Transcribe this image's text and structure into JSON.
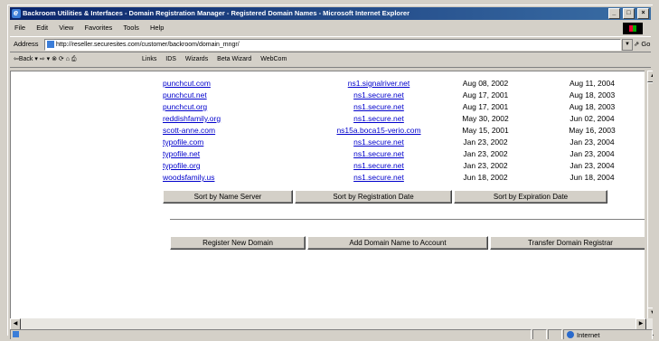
{
  "window": {
    "title": "Backroom Utilities & Interfaces - Domain Registration Manager - Registered Domain Names - Microsoft Internet Explorer",
    "controls": [
      "_",
      "□",
      "×"
    ]
  },
  "menu": [
    "File",
    "Edit",
    "View",
    "Favorites",
    "Tools",
    "Help"
  ],
  "address": {
    "label": "Address",
    "url": "http://reseller.securesites.com/customer/backroom/domain_mngr/",
    "go_label": "Go"
  },
  "toolbar": {
    "nav": "⇦Back ▾ ⇨ ▾ ⊗ ⟳ ⌂ ⎙",
    "links_label": "Links",
    "links": [
      "IDS",
      "Wizards",
      "Beta Wizard",
      "WebCom"
    ]
  },
  "domains": [
    {
      "name": "punchcut.com",
      "ns": "ns1.signalriver.net",
      "reg": "Aug 08, 2002",
      "exp": "Aug 11, 2004"
    },
    {
      "name": "punchcut.net",
      "ns": "ns1.secure.net",
      "reg": "Aug 17, 2001",
      "exp": "Aug 18, 2003"
    },
    {
      "name": "punchcut.org",
      "ns": "ns1.secure.net",
      "reg": "Aug 17, 2001",
      "exp": "Aug 18, 2003"
    },
    {
      "name": "reddishfamily.org",
      "ns": "ns1.secure.net",
      "reg": "May 30, 2002",
      "exp": "Jun 02, 2004"
    },
    {
      "name": "scott-anne.com",
      "ns": "ns15a.boca15-verio.com",
      "reg": "May 15, 2001",
      "exp": "May 16, 2003"
    },
    {
      "name": "typofile.com",
      "ns": "ns1.secure.net",
      "reg": "Jan 23, 2002",
      "exp": "Jan 23, 2004"
    },
    {
      "name": "typofile.net",
      "ns": "ns1.secure.net",
      "reg": "Jan 23, 2002",
      "exp": "Jan 23, 2004"
    },
    {
      "name": "typofile.org",
      "ns": "ns1.secure.net",
      "reg": "Jan 23, 2002",
      "exp": "Jan 23, 2004"
    },
    {
      "name": "woodsfamily.us",
      "ns": "ns1.secure.net",
      "reg": "Jun 18, 2002",
      "exp": "Jun 18, 2004"
    }
  ],
  "sort_buttons": {
    "by_ns": "Sort by Name Server",
    "by_reg": "Sort by Registration Date",
    "by_exp": "Sort by Expiration Date"
  },
  "action_buttons": {
    "register": "Register New Domain",
    "add": "Add Domain Name to Account",
    "transfer": "Transfer Domain Registrar"
  },
  "status": {
    "zone": "Internet"
  },
  "colors": {
    "link": "#0000cc",
    "titlebar_start": "#0a246a",
    "titlebar_end": "#3a6ea5",
    "chrome": "#d4d0c8"
  }
}
